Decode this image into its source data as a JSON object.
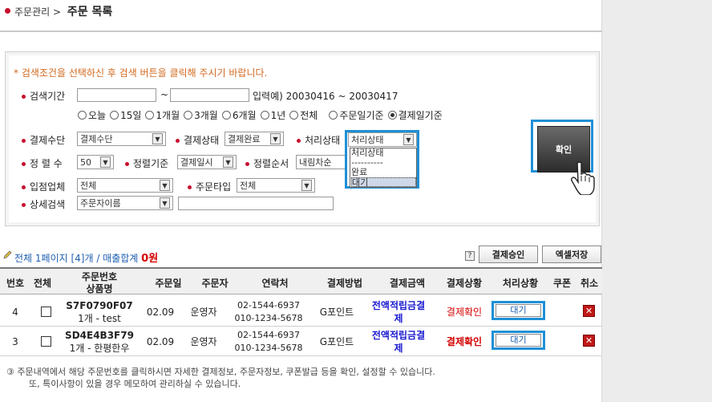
{
  "breadcrumb": {
    "section": "주문관리 >",
    "title": "주문 목록"
  },
  "search": {
    "notice": "* 검색조건을 선택하신 후 검색 버튼을 클릭해 주시기 바랍니다.",
    "period": {
      "label": "검색기간",
      "separator": "~",
      "example": "입력예) 20030416 ~ 20030417",
      "options": [
        "오늘",
        "15일",
        "1개월",
        "3개월",
        "6개월",
        "1년",
        "전체"
      ],
      "basis_options": [
        "주문일기준",
        "결제일기준"
      ],
      "basis_selected": "결제일기준"
    },
    "payment_method": {
      "label": "결제수단",
      "value": "결제수단"
    },
    "payment_status": {
      "label": "결제상태",
      "value": "결제완료"
    },
    "process_status": {
      "label": "처리상태",
      "value": "처리상태",
      "options": [
        "처리상태",
        "----------",
        "완료",
        "대기"
      ],
      "highlighted": "대기"
    },
    "page_size": {
      "label": "정 렬 수",
      "value": "50"
    },
    "sort_basis": {
      "label": "정렬기준",
      "value": "결제일시"
    },
    "sort_order": {
      "label": "정렬순서",
      "value": "내림차순"
    },
    "vendor": {
      "label": "입점업체",
      "value": "전체"
    },
    "order_type": {
      "label": "주문타입",
      "value": "전체"
    },
    "detail": {
      "label": "상세검색",
      "value": "주문자이름"
    },
    "confirm_label": "확인"
  },
  "summary": {
    "text": "전체 1페이지 [4]개 / 매출합계",
    "total": "0원",
    "approve_button": "결제승인",
    "excel_button": "엑셀저장"
  },
  "table": {
    "headers": {
      "no": "번호",
      "all": "전체",
      "order_no": "주문번호",
      "product": "상품명",
      "order_date": "주문일",
      "customer": "주문자",
      "contact": "연락처",
      "pay_method": "결제방법",
      "pay_amount": "결제금액",
      "pay_status": "결제상황",
      "process": "처리상황",
      "coupon": "쿠폰",
      "cancel": "취소"
    },
    "rows": [
      {
        "no": "4",
        "order_no": "S7F0790F07",
        "product": "1개 - test",
        "order_date": "02.09",
        "customer": "운영자",
        "phone1": "02-1544-6937",
        "phone2": "010-1234-5678",
        "pay_method": "G포인트",
        "pay_amount_1": "전액적립금결",
        "pay_amount_2": "제",
        "pay_status": "결제확인",
        "process": "대기"
      },
      {
        "no": "3",
        "order_no": "SD4E4B3F79",
        "product": "1개 - 한평한우",
        "order_date": "02.09",
        "customer": "운영자",
        "phone1": "02-1544-6937",
        "phone2": "010-1234-5678",
        "pay_method": "G포인트",
        "pay_amount_1": "전액적립금결",
        "pay_amount_2": "제",
        "pay_status": "결제확인",
        "process": "대기"
      }
    ]
  },
  "footnote": {
    "line1": "③ 주문내역에서 해당 주문번호를 클릭하시면 자세한 결제정보, 주문자정보, 쿠폰발급 등을 확인, 설정할 수 있습니다.",
    "line2": "또, 특이사항이 있을 경우 메모하여 관리하실 수 있습니다."
  },
  "colors": {
    "accent_red": "#c8102e",
    "highlight_blue": "#1e90d6",
    "link_blue": "#1a1ad0"
  }
}
